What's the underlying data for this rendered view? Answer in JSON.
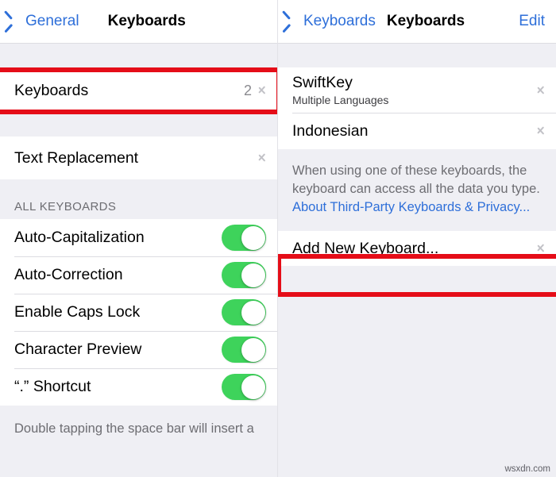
{
  "left_panel": {
    "navbar": {
      "back_label": "General",
      "back_icon": "chevron-left-icon",
      "title": "Keyboards"
    },
    "keyboards_row": {
      "label": "Keyboards",
      "value": "2",
      "chevron_icon": "chevron-right-icon"
    },
    "text_replacement_row": {
      "label": "Text Replacement",
      "chevron_icon": "chevron-right-icon"
    },
    "section_header": "ALL KEYBOARDS",
    "toggles": [
      {
        "label": "Auto-Capitalization",
        "state": "on"
      },
      {
        "label": "Auto-Correction",
        "state": "on"
      },
      {
        "label": "Enable Caps Lock",
        "state": "on"
      },
      {
        "label": "Character Preview",
        "state": "on"
      },
      {
        "label": "“.” Shortcut",
        "state": "on"
      }
    ],
    "footer_note": "Double tapping the space bar will insert a"
  },
  "right_panel": {
    "navbar": {
      "back_label": "Keyboards",
      "back_icon": "chevron-left-icon",
      "title": "Keyboards",
      "edit_label": "Edit"
    },
    "keyboard_items": [
      {
        "label": "SwiftKey",
        "sublabel": "Multiple Languages",
        "chevron_icon": "chevron-right-icon"
      },
      {
        "label": "Indonesian",
        "sublabel": "",
        "chevron_icon": "chevron-right-icon"
      }
    ],
    "privacy_note": {
      "text": "When using one of these keyboards, the keyboard can access all the data you type. ",
      "link_text": "About Third-Party Keyboards & Privacy..."
    },
    "add_row": {
      "label": "Add New Keyboard...",
      "chevron_icon": "chevron-right-icon"
    }
  },
  "annotations": {
    "highlight_color": "#e50d18",
    "boxes": [
      {
        "name": "keyboards-row-highlight"
      },
      {
        "name": "add-new-keyboard-highlight"
      }
    ]
  },
  "watermark": "wsxdn.com"
}
